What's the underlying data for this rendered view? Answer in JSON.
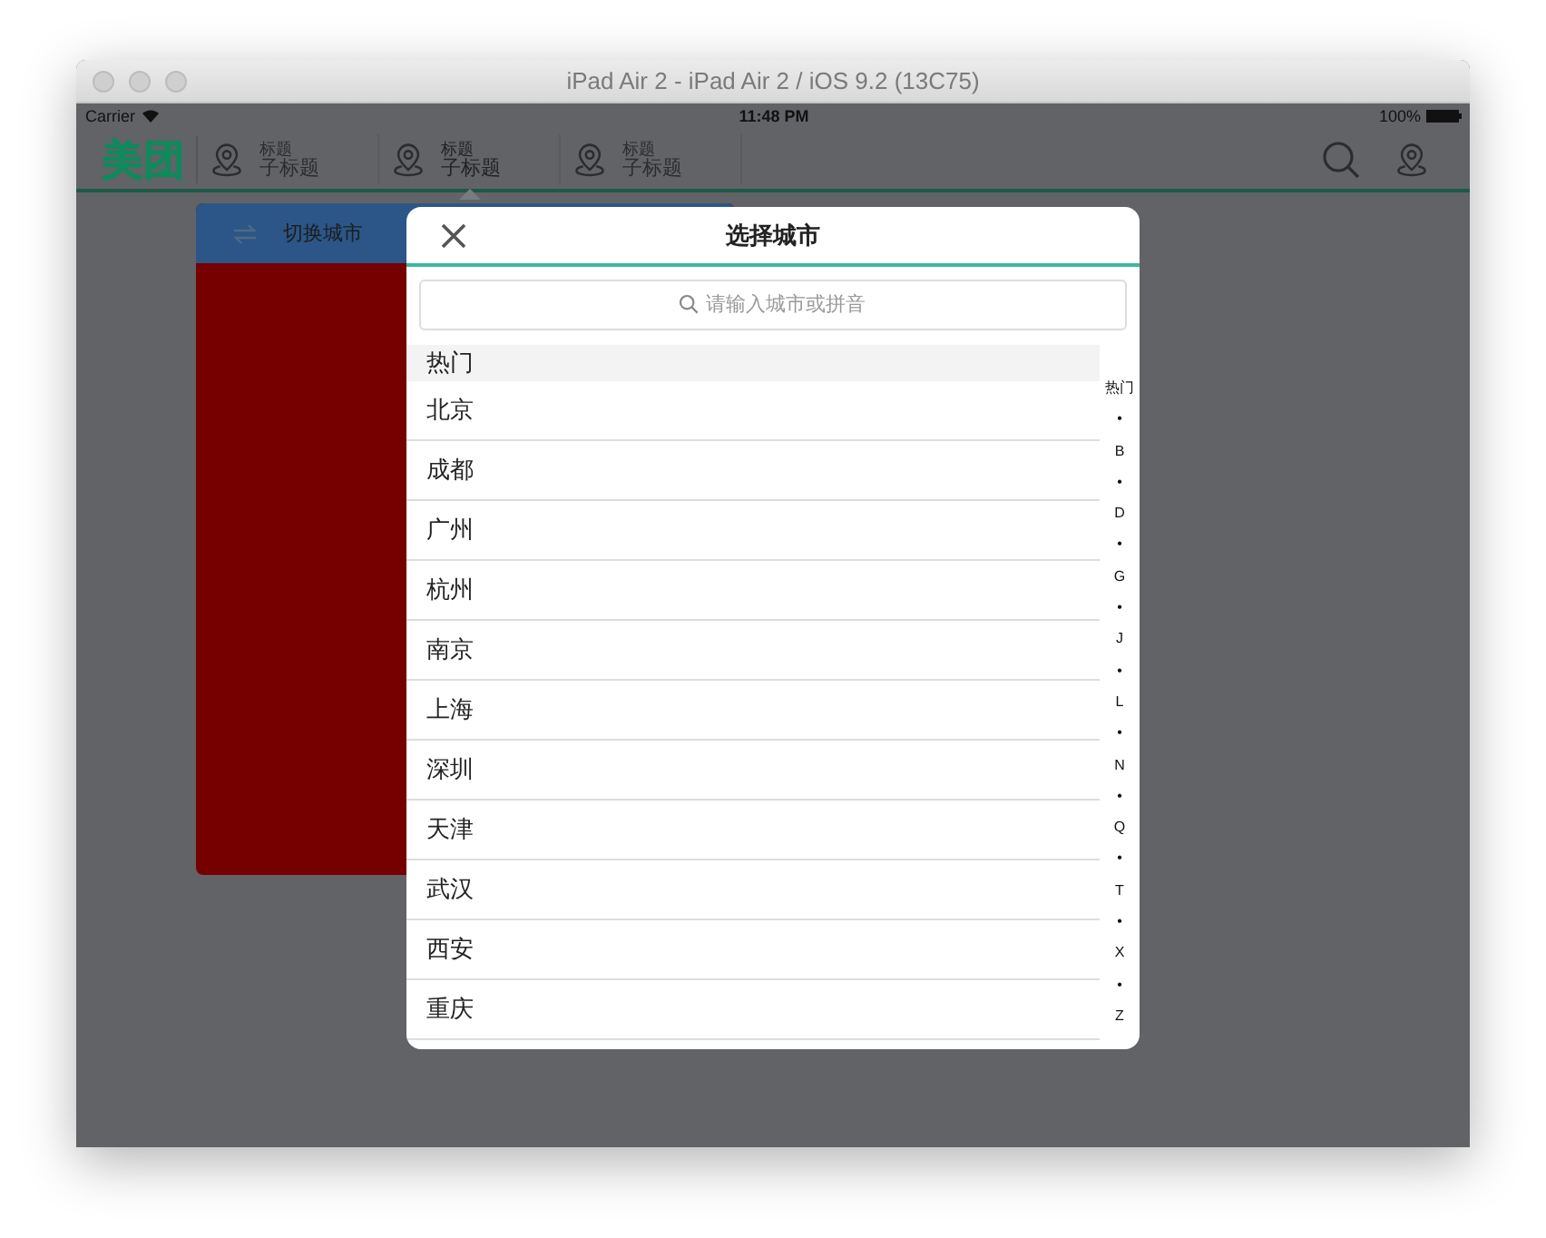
{
  "window": {
    "title": "iPad Air 2 - iPad Air 2 / iOS 9.2 (13C75)"
  },
  "status_bar": {
    "carrier": "Carrier",
    "time": "11:48 PM",
    "battery": "100%"
  },
  "nav": {
    "logo": "美团",
    "items": [
      {
        "title": "标题",
        "subtitle": "子标题",
        "selected": false
      },
      {
        "title": "标题",
        "subtitle": "子标题",
        "selected": true
      },
      {
        "title": "标题",
        "subtitle": "子标题",
        "selected": false
      }
    ]
  },
  "popover": {
    "title": "切换城市"
  },
  "dialog": {
    "title": "选择城市",
    "search": {
      "placeholder": "请输入城市或拼音"
    },
    "sections": [
      {
        "header": "热门",
        "cities": [
          "北京",
          "成都",
          "广州",
          "杭州",
          "南京",
          "上海",
          "深圳",
          "天津",
          "武汉",
          "西安",
          "重庆"
        ]
      }
    ],
    "index": [
      "热门",
      "•",
      "B",
      "•",
      "D",
      "•",
      "G",
      "•",
      "J",
      "•",
      "L",
      "•",
      "N",
      "•",
      "Q",
      "•",
      "T",
      "•",
      "X",
      "•",
      "Z"
    ]
  }
}
